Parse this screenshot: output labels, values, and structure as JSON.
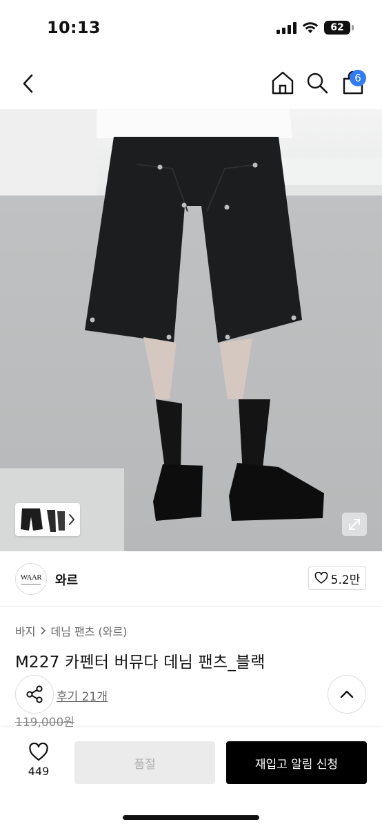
{
  "status_bar": {
    "time": "10:13",
    "battery": "62",
    "icons": [
      "signal-icon",
      "wifi-icon",
      "battery-icon"
    ]
  },
  "nav": {
    "icons": [
      "back-chevron-icon",
      "home-icon",
      "search-icon",
      "shopping-bag-icon"
    ],
    "cart_count": "6"
  },
  "product_image": {
    "thumbnail_icon": "shorts-thumbnail",
    "expand_icon": "expand-icon"
  },
  "brand": {
    "logo_text": "WAAR",
    "name": "와르",
    "like_count": "5.2만"
  },
  "product": {
    "breadcrumb": [
      "바지",
      "데님 팬츠 (와르)"
    ],
    "title": "M227 카펜터 버뮤다 데님 팬츠_블랙",
    "reviews": "후기 21개",
    "original_price": "119,000원"
  },
  "actions": {
    "wish_count": "449",
    "soldout_label": "품절",
    "restock_label": "재입고 알림 신청"
  },
  "colors": {
    "badge": "#2f7cf6",
    "primary_button": "#000000",
    "disabled_button": "#ebebeb"
  }
}
